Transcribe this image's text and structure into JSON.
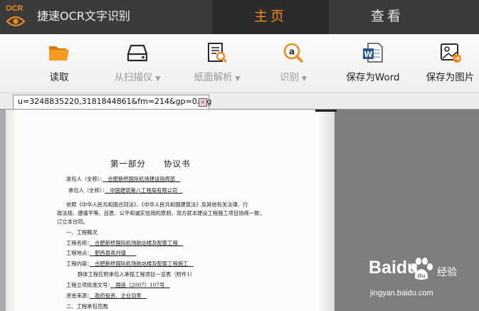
{
  "app": {
    "logo_text": "OCR",
    "title": "捷速OCR文字识别"
  },
  "nav": {
    "home": "主页",
    "view": "查看"
  },
  "toolbar": {
    "read": "读取",
    "scan": "从扫描仪",
    "parse": "纸面解析",
    "recognize": "识别",
    "save_word": "保存为Word",
    "save_image": "保存为图片"
  },
  "document_tab": {
    "name": "u=3248835220,3181844861&fm=214&gp=0.jpg",
    "close": "×"
  },
  "document": {
    "heading": "第一部分　　协议书",
    "employer_label": "发包人（全称）：",
    "employer_value": "　合肥新桥国际机场建设指挥部　",
    "contractor_label": "承包人（全称）：",
    "contractor_value": "　中国建筑第八工程局有限公司　",
    "para1_line1": "依照《中华人民共和国合同法》、《中华人民共和国建筑法》及其他有关法律、行",
    "para1_line2": "政法规、遵循平等、自愿、公平和诚实信用的原则，双方就本建设工程施工项目协商一致，",
    "para1_line3": "订立本合同。",
    "sec1": "一、工程概况",
    "project_name_label": "工程名称：",
    "project_name_value": "　合肥新桥国际机场航站楼及配套工程　",
    "location_label": "工程地点：",
    "location_value": "　肥西县高刘镇　　",
    "content_label": "工程内容：",
    "content_value": "　合肥新桥国际机场航站楼及配套工程施工　",
    "group_note": "群体工程应附承包人承揽工程项目一览表（附件1）",
    "approval_label": "工程立项批准文号：",
    "approval_value": "　国函〔2007〕107号　",
    "funding_label": "资金来源：",
    "funding_value": "　政府投资、企业自筹　",
    "sec2": "二、工程承包范围"
  },
  "watermark": {
    "brand": "Baidu",
    "brand2": "经验",
    "url": "jingyan.baidu.com"
  },
  "colors": {
    "accent": "#f08a1c",
    "titlebar": "#3b3b3b",
    "word_blue": "#2b5797"
  }
}
